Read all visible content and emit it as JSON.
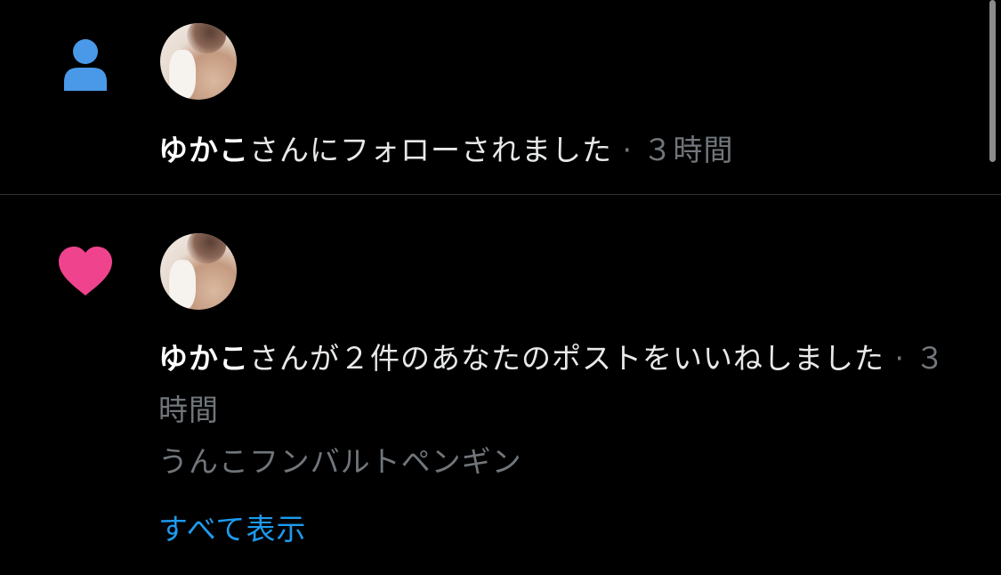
{
  "colors": {
    "background": "#000000",
    "follow_icon": "#4a99e9",
    "like_icon": "#f0438d",
    "text_primary": "#e7e9ea",
    "text_secondary": "#71767b",
    "link": "#1d9bf0"
  },
  "notifications": [
    {
      "type_icon": "person-icon",
      "user_name": "ゆかこ",
      "action": "さんにフォローされました",
      "separator": " · ",
      "time": "３時間"
    },
    {
      "type_icon": "heart-icon",
      "user_name": "ゆかこ",
      "action": "さんが２件のあなたのポストをいいねしました",
      "separator": " · ",
      "time": "３時間",
      "post_preview": "うんこフンバルトペンギン",
      "show_all_label": "すべて表示"
    }
  ]
}
